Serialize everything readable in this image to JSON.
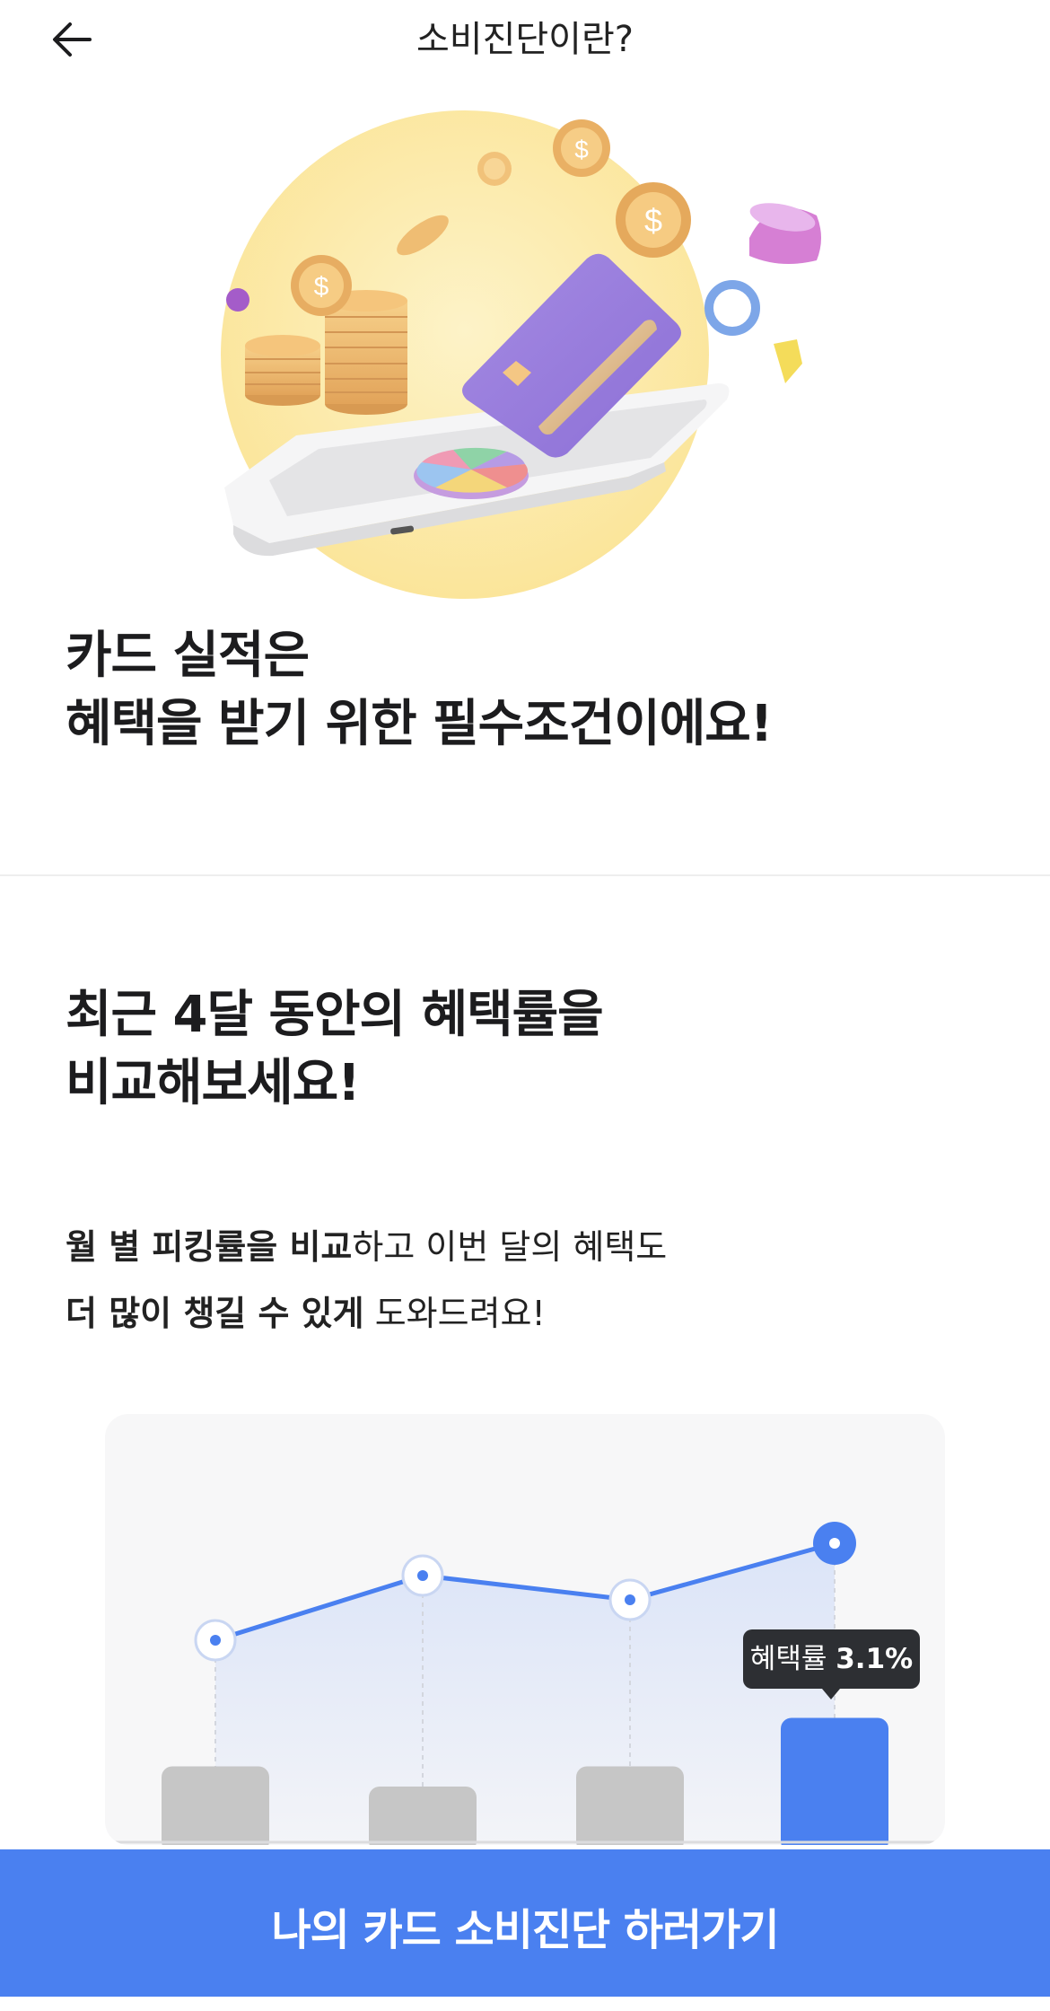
{
  "header": {
    "title": "소비진단이란?",
    "back_icon": "arrow-left-icon"
  },
  "hero": {
    "illustration": "card-payment-illustration"
  },
  "section1": {
    "headline_line1": "카드 실적은",
    "headline_line2": "혜택을 받기 위한 필수조건이에요!"
  },
  "section2": {
    "headline_line1": "최근 4달 동안의 혜택률을",
    "headline_line2": "비교해보세요!",
    "desc_line1_bold": "월 별 피킹률을 비교",
    "desc_line1_rest": "하고 이번 달의 혜택도",
    "desc_line2_bold": "더 많이 챙길 수 있게",
    "desc_line2_rest": " 도와드려요!"
  },
  "chart_data": {
    "type": "bar",
    "categories": [
      "",
      "",
      "",
      ""
    ],
    "values": [
      1.9,
      1.4,
      1.9,
      3.1
    ],
    "line_values": [
      2.0,
      2.8,
      2.5,
      3.2
    ],
    "highlight_index": 3,
    "tooltip_label": "혜택률",
    "tooltip_value": "3.1%",
    "colors": {
      "bar": "#c6c6c6",
      "bar_highlight": "#4a80f0",
      "line": "#4a80f0"
    }
  },
  "cta": {
    "label": "나의 카드 소비진단 하러가기"
  }
}
